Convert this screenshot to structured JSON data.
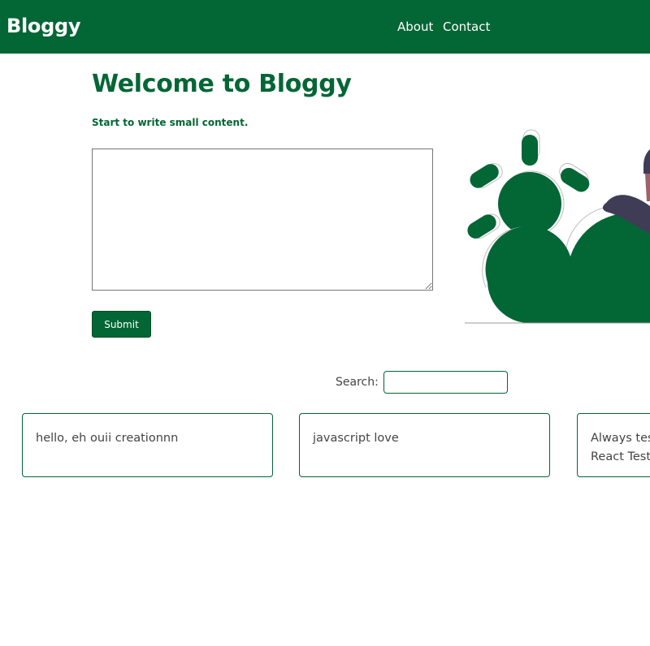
{
  "header": {
    "brand": "Bloggy",
    "nav": {
      "about": "About",
      "contact": "Contact"
    }
  },
  "hero": {
    "title": "Welcome to Bloggy",
    "subtitle": "Start to write small content.",
    "editor_value": "",
    "submit_label": "Submit"
  },
  "search": {
    "label": "Search:",
    "value": ""
  },
  "posts": [
    {
      "text": "hello, eh ouii creationnn"
    },
    {
      "text": "javascript love"
    },
    {
      "text": "Always testing with React Testing Library"
    }
  ],
  "colors": {
    "primary": "#036635",
    "figure_dark": "#3f3d56"
  }
}
